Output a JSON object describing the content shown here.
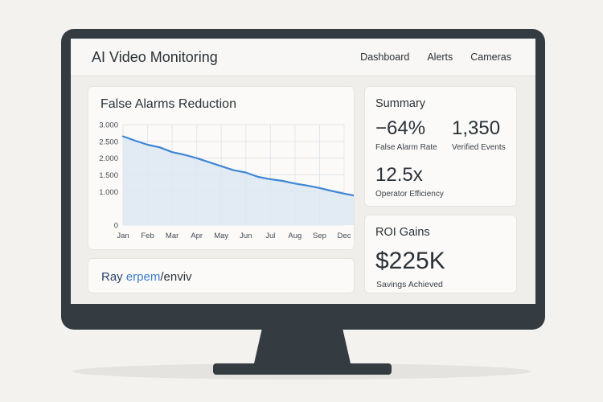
{
  "header": {
    "title": "AI Video Monitoring",
    "nav": [
      "Dashboard",
      "Alerts",
      "Cameras"
    ]
  },
  "chart_card": {
    "title": "False Alarms Reduction"
  },
  "chart_data": {
    "type": "area",
    "categories": [
      "Jan",
      "Feb",
      "Mar",
      "Apr",
      "May",
      "Jun",
      "Jul",
      "Aug",
      "Sep",
      "Dec"
    ],
    "y_tick_labels": [
      "3.000",
      "2.500",
      "2.000",
      "1.500",
      "1.000",
      "0"
    ],
    "y_ticks": [
      3000,
      2500,
      2000,
      1500,
      1000,
      0
    ],
    "ylim": [
      0,
      3000
    ],
    "x": [
      0,
      0.5,
      1,
      1.5,
      2,
      2.5,
      3,
      3.5,
      4,
      4.5,
      5,
      5.5,
      6,
      6.5,
      7,
      7.5,
      8,
      8.5,
      9,
      9.5,
      10
    ],
    "values": [
      2650,
      2520,
      2400,
      2320,
      2180,
      2100,
      2000,
      1880,
      1760,
      1640,
      1570,
      1440,
      1370,
      1320,
      1240,
      1180,
      1110,
      1020,
      940,
      870,
      810
    ],
    "grid": true,
    "line_color": "#3d86d4",
    "fill_color": "#dde7f2"
  },
  "brand": {
    "part1": "Ray ",
    "part2": "erpem",
    "part3": "/enviv"
  },
  "summary": {
    "title": "Summary",
    "metrics": [
      {
        "value": "−64%",
        "label": "False Alarm Rate"
      },
      {
        "value": "1,350",
        "label": "Verified Events"
      },
      {
        "value": "12.5x",
        "label": "Operator Efficiency"
      }
    ]
  },
  "roi": {
    "title": "ROI Gains",
    "value": "$225K",
    "label": "Savings Achieved"
  },
  "colors": {
    "background": "#f3f2ef",
    "bezel": "#343b41",
    "accent": "#3d86d4"
  }
}
